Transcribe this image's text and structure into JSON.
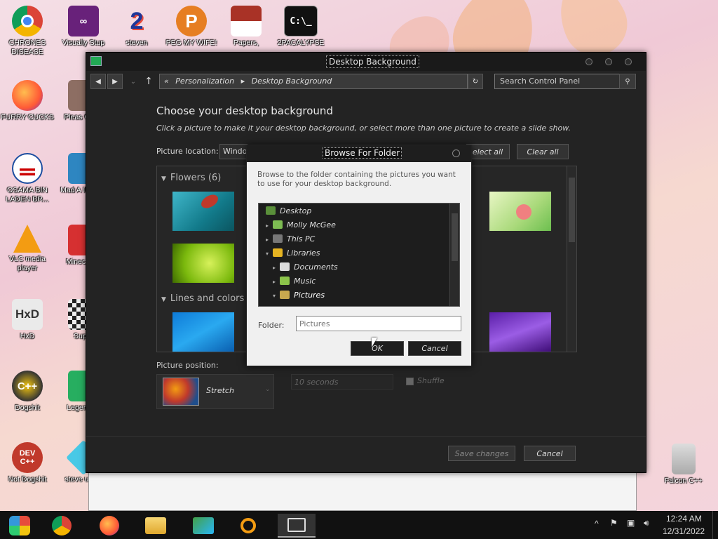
{
  "desktop": {
    "icons_left": [
      {
        "label": "CHRONES DISEASE",
        "icon": "chrome-icon"
      },
      {
        "label": "FURRY CUCKS",
        "icon": "firefox-icon"
      },
      {
        "label": "OSAMA BIN LADEN BR...",
        "icon": "obama-logo-icon"
      },
      {
        "label": "VLC media player",
        "icon": "vlc-icon"
      },
      {
        "label": "HxD",
        "icon": "hxd-icon"
      },
      {
        "label": "Dogshit",
        "icon": "dogshit-icon"
      },
      {
        "label": "Not Dogshit",
        "icon": "devcpp-icon"
      }
    ],
    "icons_col2": [
      {
        "label": "Visually Stup",
        "icon": "visual-studio-icon"
      },
      {
        "label": "Pleas Chick",
        "icon": "game-icon"
      },
      {
        "label": "Mad A IN SPA",
        "icon": "angry-birds-space-icon"
      },
      {
        "label": "Minec Bird",
        "icon": "angry-birds-icon"
      },
      {
        "label": "Super",
        "icon": "checker-icon"
      },
      {
        "label": "Legen Z:d",
        "icon": "zelda-icon"
      },
      {
        "label": "steve unive",
        "icon": "diamond-icon"
      }
    ],
    "icons_top": [
      {
        "label": "steven",
        "icon": "number-2-icon"
      },
      {
        "label": "PEG MY WIFE!",
        "icon": "p-logo-icon"
      },
      {
        "label": "Papers,",
        "icon": "papers-please-icon"
      },
      {
        "label": "2PACALYPSE",
        "icon": "cmd-icon"
      }
    ],
    "recycle_label": "Falcon C++"
  },
  "window": {
    "title": "Desktop Background",
    "breadcrumb": [
      "«",
      "Personalization",
      "▸",
      "Desktop Background"
    ],
    "search_placeholder": "Search Control Panel",
    "heading": "Choose your desktop background",
    "subheading": "Click a picture to make it your desktop background, or select more than one picture to create a slide show.",
    "picture_location_label": "Picture location:",
    "picture_location_value": "Windo",
    "select_all": "elect all",
    "clear_all": "Clear all",
    "groups": [
      "Flowers (6)",
      "Lines and colors ("
    ],
    "picture_position_label": "Picture position:",
    "position_value": "Stretch",
    "interval_value": "10 seconds",
    "shuffle_label": "Shuffle",
    "save_changes": "Save changes",
    "cancel": "Cancel"
  },
  "dialog": {
    "title": "Browse For Folder",
    "description": "Browse to the folder containing the pictures you want to use for your desktop background.",
    "tree": [
      {
        "label": "Desktop",
        "level": 0
      },
      {
        "label": "Molly McGee",
        "level": 1
      },
      {
        "label": "This PC",
        "level": 1
      },
      {
        "label": "Libraries",
        "level": 1
      },
      {
        "label": "Documents",
        "level": 2
      },
      {
        "label": "Music",
        "level": 2
      },
      {
        "label": "Pictures",
        "level": 2
      }
    ],
    "folder_label": "Folder:",
    "folder_value": "Pictures",
    "ok": "OK",
    "cancel": "Cancel"
  },
  "taskbar": {
    "apps": [
      "start-icon",
      "chrome-icon",
      "firefox-icon",
      "file-explorer-icon",
      "network-icon",
      "search-icon",
      "control-panel-icon"
    ],
    "time": "12:24 AM",
    "date": "12/31/2022"
  }
}
